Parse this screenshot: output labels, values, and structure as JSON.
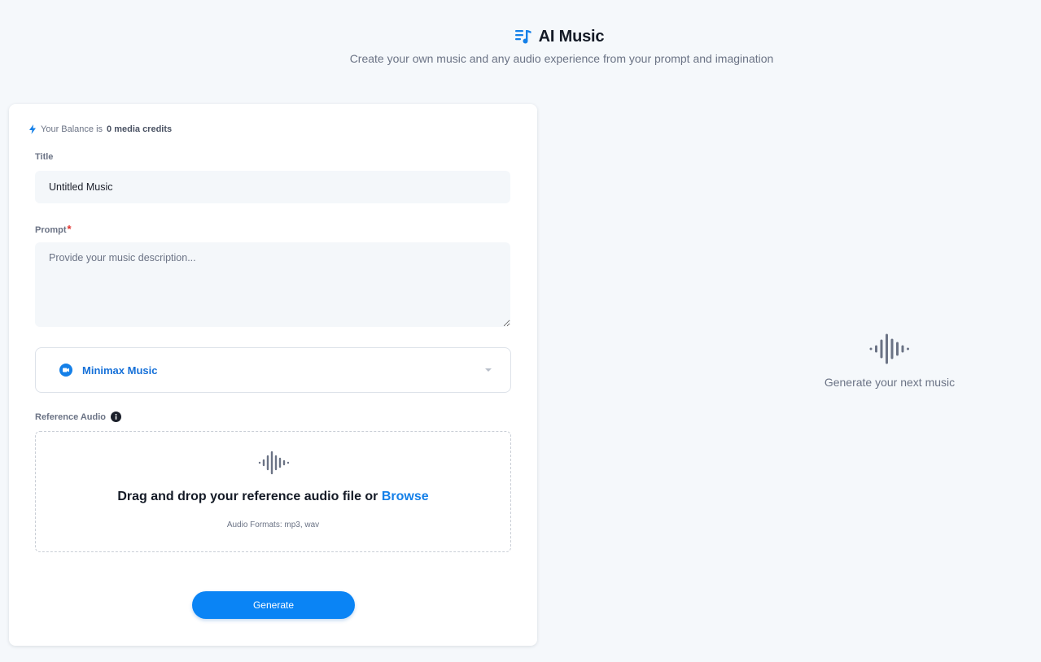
{
  "header": {
    "icon": "music-list-icon",
    "title": "AI Music",
    "subtitle": "Create your own music and any audio experience from your prompt and imagination"
  },
  "form": {
    "balance": {
      "icon": "bolt-icon",
      "prefix": "Your Balance is",
      "amount": "0 media credits"
    },
    "title_field": {
      "label": "Title",
      "value": "Untitled Music"
    },
    "prompt_field": {
      "label": "Prompt",
      "required_mark": "*",
      "placeholder": "Provide your music description..."
    },
    "model_select": {
      "icon": "video-camera-icon",
      "selected": "Minimax Music"
    },
    "reference_audio": {
      "label": "Reference Audio",
      "info_icon": "info-icon",
      "drop_text": "Drag and drop your reference audio file or",
      "browse_label": "Browse",
      "formats": "Audio Formats: mp3, wav"
    },
    "generate_label": "Generate"
  },
  "empty_state": {
    "icon": "audio-wave-icon",
    "text": "Generate your next music"
  },
  "colors": {
    "background": "#f5f8fb",
    "accent": "#0a84f5",
    "link": "#1580e8",
    "required": "#e0312c",
    "muted_text": "#6b7385"
  }
}
